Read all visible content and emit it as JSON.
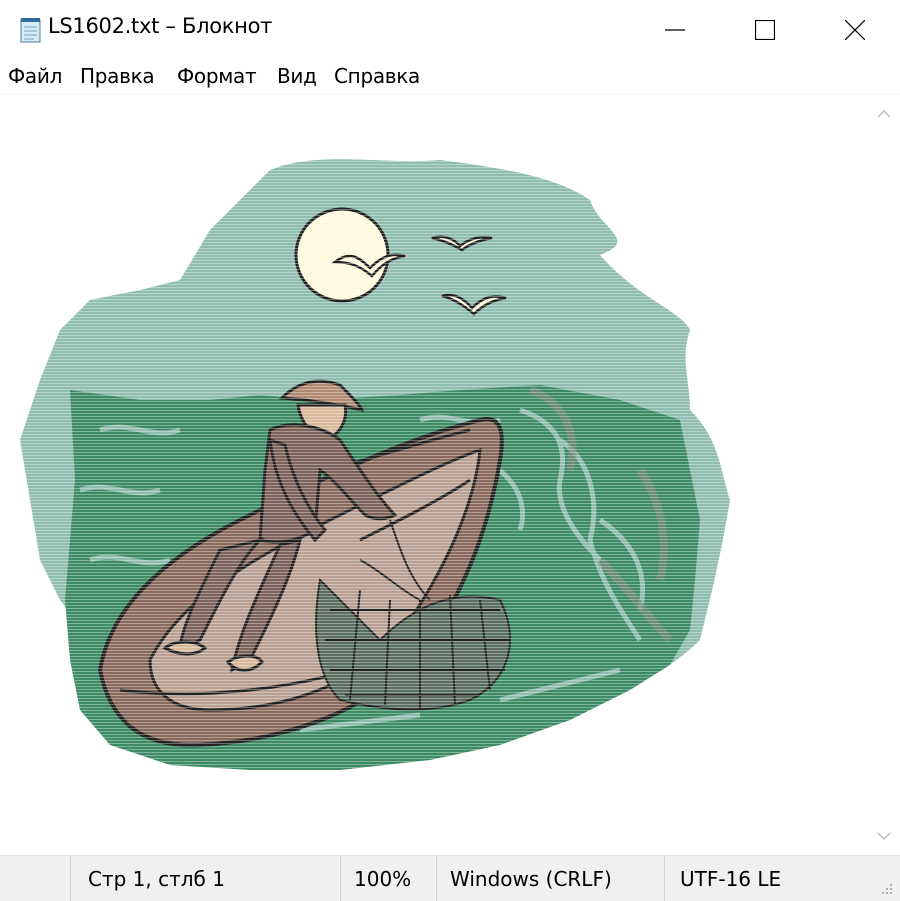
{
  "window": {
    "title": "LS1602.txt – Блокнот"
  },
  "menu": {
    "items": [
      "Файл",
      "Правка",
      "Формат",
      "Вид",
      "Справка"
    ]
  },
  "content": {
    "image_description_icon": "fisherman-ascii-art"
  },
  "status": {
    "position": "Стр 1, стлб 1",
    "zoom": "100%",
    "line_endings": "Windows (CRLF)",
    "encoding": "UTF-16 LE"
  },
  "colors": {
    "sky": "#8fbdaf",
    "water": "#3d8b66",
    "boat": "#8a6a5c",
    "moon": "#fdf9dc",
    "status_bg": "#f0f0f0"
  }
}
